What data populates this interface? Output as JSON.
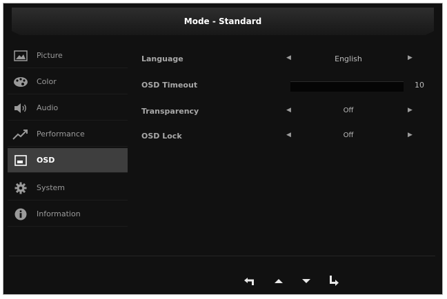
{
  "header": {
    "title": "Mode - Standard"
  },
  "sidebar": {
    "items": [
      {
        "label": "Picture",
        "icon": "picture-icon",
        "selected": false
      },
      {
        "label": "Color",
        "icon": "color-palette-icon",
        "selected": false
      },
      {
        "label": "Audio",
        "icon": "speaker-icon",
        "selected": false
      },
      {
        "label": "Performance",
        "icon": "performance-chart-icon",
        "selected": false
      },
      {
        "label": "OSD",
        "icon": "osd-window-icon",
        "selected": true
      },
      {
        "label": "System",
        "icon": "gear-icon",
        "selected": false
      },
      {
        "label": "Information",
        "icon": "info-icon",
        "selected": false
      }
    ]
  },
  "settings": {
    "language": {
      "label": "Language",
      "value": "English"
    },
    "osd_timeout": {
      "label": "OSD Timeout",
      "value": "10",
      "level": 0
    },
    "transparency": {
      "label": "Transparency",
      "value": "Off"
    },
    "osd_lock": {
      "label": "OSD Lock",
      "value": "Off"
    }
  },
  "navigation": {
    "icons": [
      "back-arrow-icon",
      "up-arrow-icon",
      "down-arrow-icon",
      "enter-arrow-icon"
    ]
  },
  "colors": {
    "background": "#111111",
    "selected_item": "#3e3e3e",
    "text": "#cfcfcf"
  }
}
